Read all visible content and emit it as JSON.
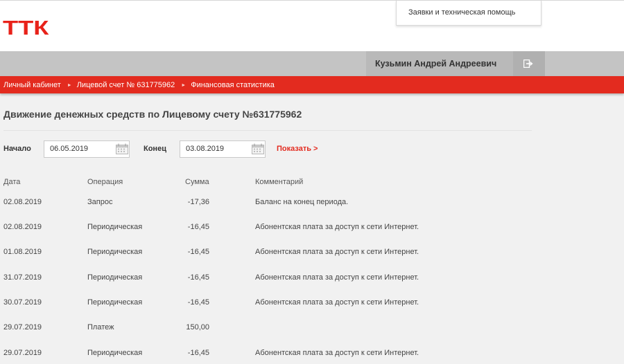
{
  "header": {
    "logo": "ТТК",
    "help_link": "Заявки и техническая помощь"
  },
  "userbar": {
    "user_name": "Кузьмин Андрей Андреевич",
    "logout_icon": "logout-icon"
  },
  "breadcrumbs": [
    "Личный кабинет",
    "Лицевой счет № 631775962",
    "Финансовая статистика"
  ],
  "page": {
    "title": "Движение денежных средств по Лицевому счету №631775962"
  },
  "filter": {
    "start_label": "Начало",
    "start_value": "06.05.2019",
    "end_label": "Конец",
    "end_value": "03.08.2019",
    "show_label": "Показать >",
    "calendar_icon": "calendar-icon"
  },
  "table": {
    "headers": [
      "Дата",
      "Операция",
      "Сумма",
      "Комментарий"
    ],
    "rows": [
      {
        "date": "02.08.2019",
        "op": "Запрос",
        "sum": "-17,36",
        "comment": "Баланс на конец периода."
      },
      {
        "date": "02.08.2019",
        "op": "Периодическая",
        "sum": "-16,45",
        "comment": "Абонентская плата за доступ к сети Интернет."
      },
      {
        "date": "01.08.2019",
        "op": "Периодическая",
        "sum": "-16,45",
        "comment": "Абонентская плата за доступ к сети Интернет."
      },
      {
        "date": "31.07.2019",
        "op": "Периодическая",
        "sum": "-16,45",
        "comment": "Абонентская плата за доступ к сети Интернет."
      },
      {
        "date": "30.07.2019",
        "op": "Периодическая",
        "sum": "-16,45",
        "comment": "Абонентская плата за доступ к сети Интернет."
      },
      {
        "date": "29.07.2019",
        "op": "Платеж",
        "sum": "150,00",
        "comment": ""
      },
      {
        "date": "29.07.2019",
        "op": "Периодическая",
        "sum": "-16,45",
        "comment": "Абонентская плата за доступ к сети Интернет."
      }
    ]
  }
}
